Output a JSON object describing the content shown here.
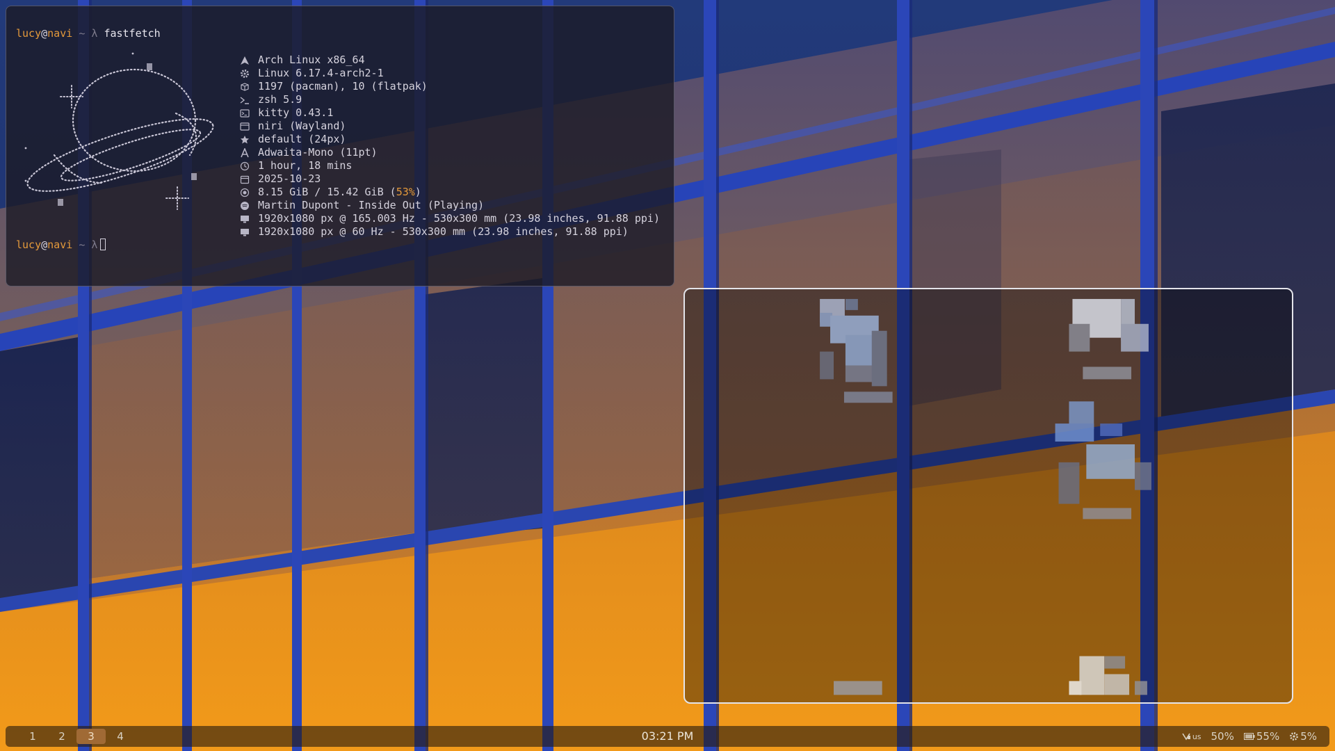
{
  "terminal": {
    "prompt1": {
      "user": "lucy",
      "host": "navi",
      "dir": "~",
      "symbol": "λ",
      "command": "fastfetch"
    },
    "prompt2": {
      "user": "lucy",
      "host": "navi",
      "dir": "~",
      "symbol": "λ"
    },
    "info": [
      {
        "icon": "arch-logo-icon",
        "text": "Arch Linux x86_64"
      },
      {
        "icon": "gear-icon",
        "text": "Linux 6.17.4-arch2-1"
      },
      {
        "icon": "package-icon",
        "text": "1197 (pacman), 10 (flatpak)"
      },
      {
        "icon": "shell-prompt-icon",
        "text": "zsh 5.9"
      },
      {
        "icon": "terminal-icon",
        "text": "kitty 0.43.1"
      },
      {
        "icon": "window-icon",
        "text": "niri (Wayland)"
      },
      {
        "icon": "star-icon",
        "text": "default (24px)"
      },
      {
        "icon": "font-icon",
        "text": "Adwaita-Mono (11pt)"
      },
      {
        "icon": "clock-icon",
        "text": "1 hour, 18 mins"
      },
      {
        "icon": "calendar-icon",
        "text": "2025-10-23"
      },
      {
        "icon": "memory-icon",
        "text": "8.15 GiB / 15.42 GiB (",
        "highlight": "53%",
        "suffix": ")"
      },
      {
        "icon": "music-icon",
        "text": "Martin Dupont - Inside Out (Playing)"
      },
      {
        "icon": "monitor-icon",
        "text": "1920x1080 px @ 165.003 Hz - 530x300 mm (23.98 inches, 91.88 ppi)"
      },
      {
        "icon": "monitor-icon",
        "text": "1920x1080 px @ 60 Hz - 530x300 mm (23.98 inches, 91.88 ppi)"
      }
    ]
  },
  "bar": {
    "workspaces": [
      "1",
      "2",
      "3",
      "4"
    ],
    "active_workspace": "3",
    "clock": "03:21 PM",
    "tray": {
      "keyboard_layout": "us",
      "volume": "50%",
      "battery": "55%",
      "cpu": "5%"
    }
  },
  "colors": {
    "accent": "#e59a3b",
    "terminal_bg": "#1c1a26",
    "workspace_active": "#a06a35"
  }
}
